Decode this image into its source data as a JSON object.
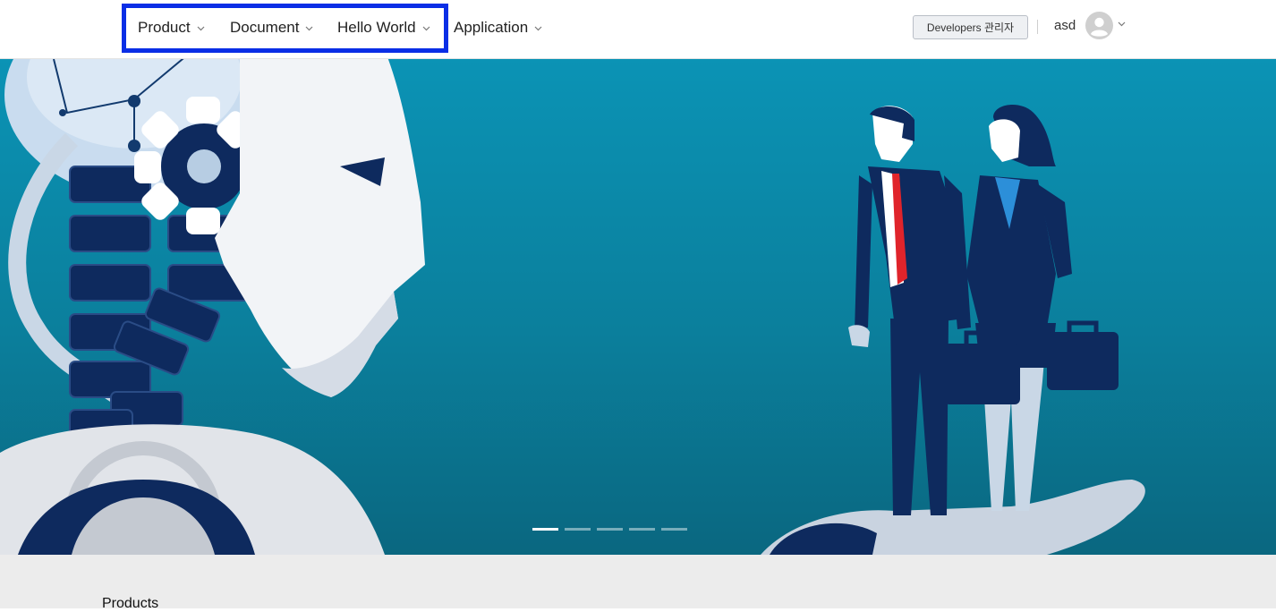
{
  "nav": {
    "items": [
      {
        "label": "Product"
      },
      {
        "label": "Document"
      },
      {
        "label": "Hello World"
      },
      {
        "label": "Application"
      }
    ]
  },
  "header": {
    "developers_button": "Developers 관리자",
    "username": "asd"
  },
  "carousel": {
    "slide_count": 5,
    "active_index": 0
  },
  "section": {
    "title": "Products"
  },
  "colors": {
    "highlight": "#0a2ee6",
    "hero_bg": "#0b8aa9",
    "navy": "#0e2a5e"
  }
}
